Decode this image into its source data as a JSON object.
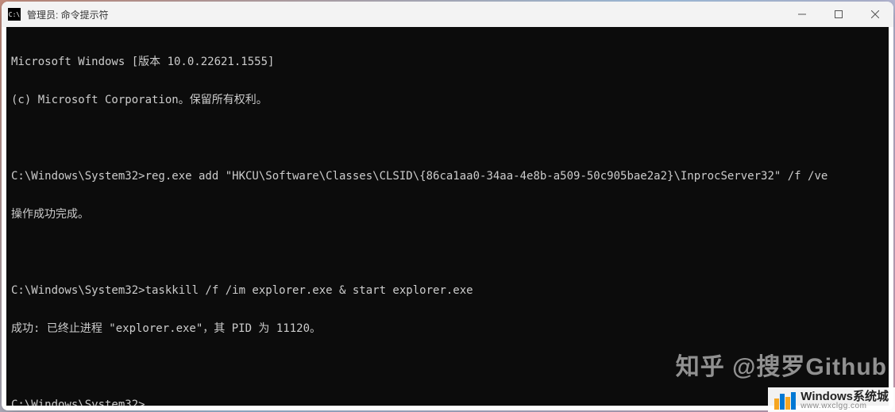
{
  "window": {
    "title": "管理员: 命令提示符",
    "icon_label": "C:\\"
  },
  "terminal": {
    "lines": [
      "Microsoft Windows [版本 10.0.22621.1555]",
      "(c) Microsoft Corporation。保留所有权利。",
      "",
      "C:\\Windows\\System32>reg.exe add \"HKCU\\Software\\Classes\\CLSID\\{86ca1aa0-34aa-4e8b-a509-50c905bae2a2}\\InprocServer32\" /f /ve",
      "操作成功完成。",
      "",
      "C:\\Windows\\System32>taskkill /f /im explorer.exe & start explorer.exe",
      "成功: 已终止进程 \"explorer.exe\"，其 PID 为 11120。",
      "",
      "C:\\Windows\\System32>"
    ]
  },
  "watermark": {
    "text": "知乎 @搜罗Github"
  },
  "brand": {
    "title": "Windows系统城",
    "subtitle": "www.wxclgg.com"
  }
}
